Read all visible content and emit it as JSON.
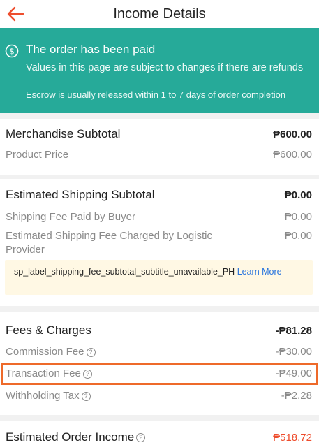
{
  "header": {
    "title": "Income Details"
  },
  "banner": {
    "title": "The order has been paid",
    "desc": "Values in this page are subject to changes if there are refunds",
    "note": "Escrow is usually released within 1 to 7 days of order completion"
  },
  "merchandise": {
    "title": "Merchandise Subtotal",
    "total": "₱600.00",
    "product_label": "Product Price",
    "product_value": "₱600.00"
  },
  "shipping": {
    "title": "Estimated Shipping Subtotal",
    "total": "₱0.00",
    "buyer_label": "Shipping Fee Paid by Buyer",
    "buyer_value": "₱0.00",
    "logistic_label": "Estimated Shipping Fee Charged by Logistic Provider",
    "logistic_value": "₱0.00",
    "notice_text": "sp_label_shipping_fee_subtotal_subtitle_unavailable_PH",
    "notice_link": "Learn More"
  },
  "fees": {
    "title": "Fees & Charges",
    "total": "-₱81.28",
    "commission_label": "Commission Fee",
    "commission_value": "-₱30.00",
    "transaction_label": "Transaction Fee",
    "transaction_value": "-₱49.00",
    "withholding_label": "Withholding Tax",
    "withholding_value": "-₱2.28"
  },
  "income": {
    "title": "Estimated Order Income",
    "value": "₱518.72"
  },
  "colors": {
    "accent": "#ee4d2d",
    "banner": "#26aa99",
    "highlight": "#ee6a2a",
    "link": "#2673dd"
  }
}
